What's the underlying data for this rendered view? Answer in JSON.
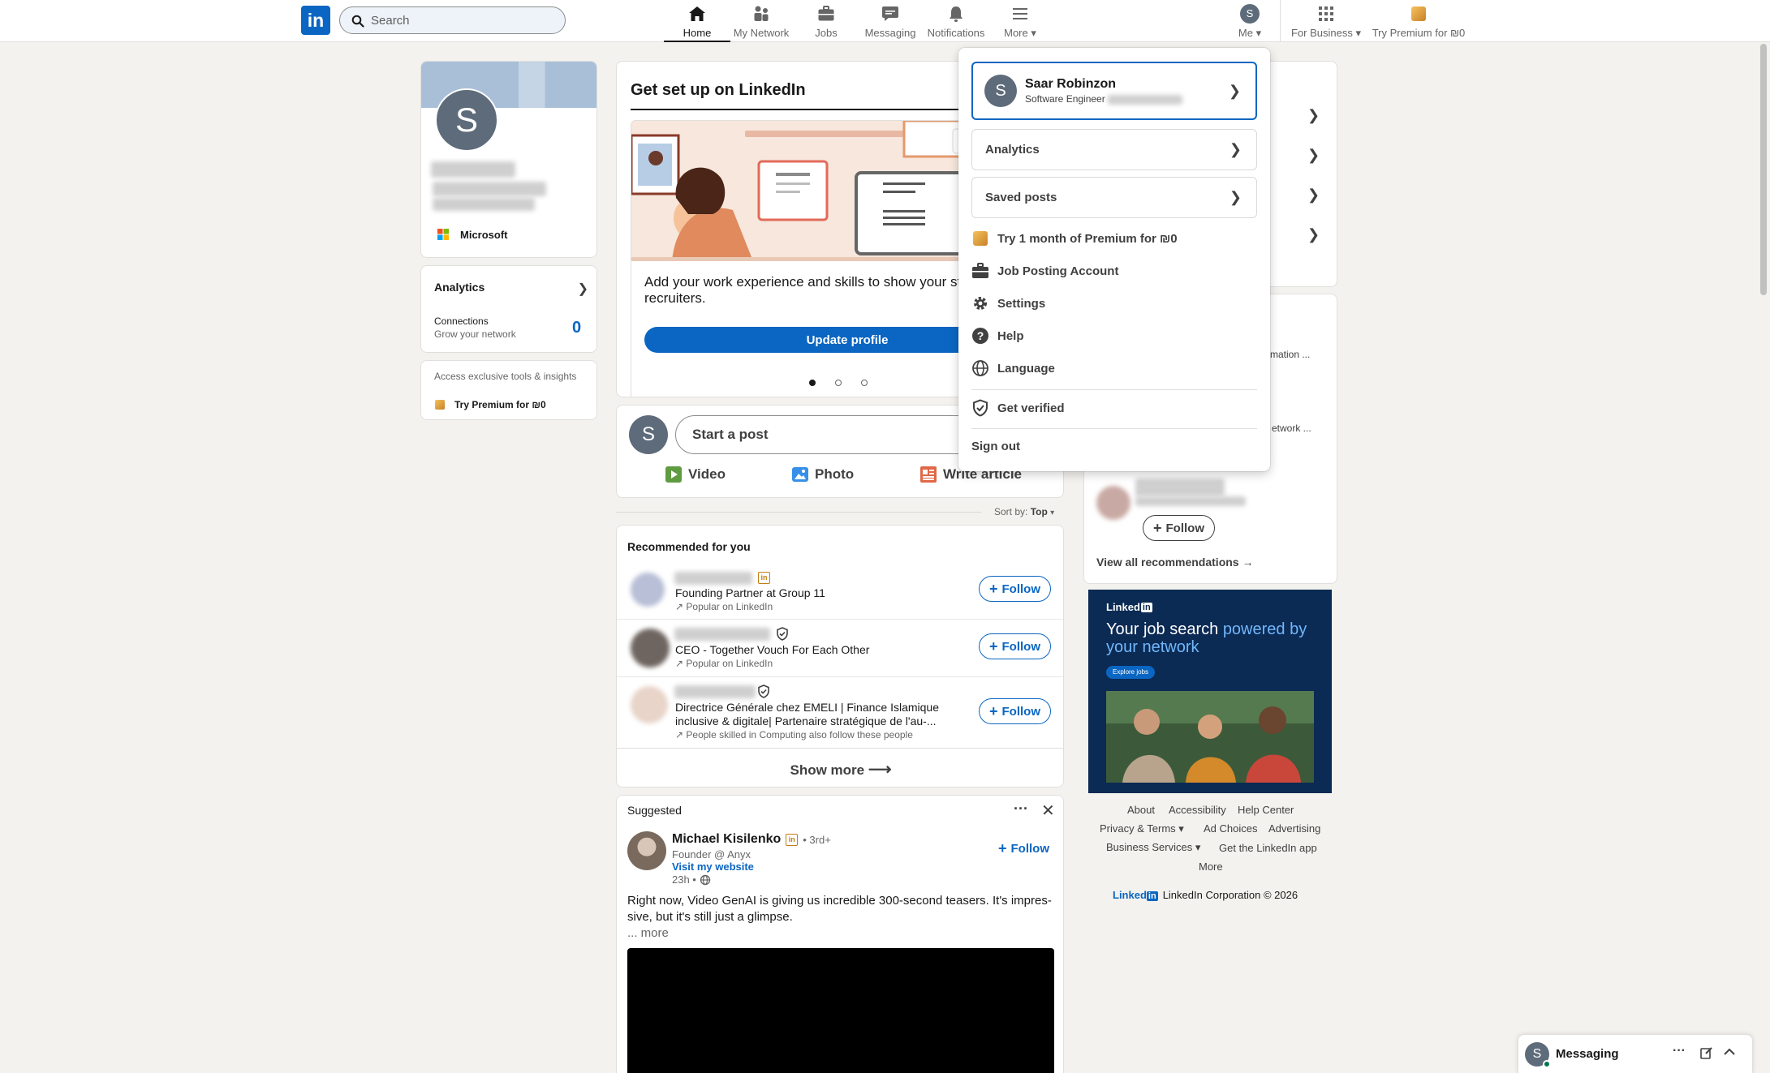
{
  "nav": {
    "logo": "in",
    "search_placeholder": "Search",
    "items": [
      {
        "label": "Home",
        "icon": "home-icon"
      },
      {
        "label": "My Network",
        "icon": "network-icon"
      },
      {
        "label": "Jobs",
        "icon": "jobs-icon"
      },
      {
        "label": "Messaging",
        "icon": "messaging-icon"
      },
      {
        "label": "Notifications",
        "icon": "bell-icon"
      },
      {
        "label": "More",
        "icon": "menu-icon"
      },
      {
        "label": "Me",
        "icon": "avatar"
      },
      {
        "label": "For Business",
        "icon": "grid-icon"
      },
      {
        "label": "Try Premium for ₪0",
        "icon": "premium-icon"
      }
    ],
    "avatar_letter": "S"
  },
  "profile_card": {
    "avatar_letter": "S",
    "company": "Microsoft",
    "analytics_label": "Analytics",
    "connections_label": "Connections",
    "connections_sub": "Grow your network",
    "connections_count": "0",
    "premium_text": "Access exclusive tools & insights",
    "premium_link": "Try Premium for ₪0"
  },
  "setup_card": {
    "title": "Get set up on LinkedIn",
    "text": "Add your work experience and skills to show your strengths to recruiters.",
    "text_visible": "Add your work experience and skills to show your stre",
    "text_line2": "recruiters.",
    "button": "Update profile"
  },
  "post_box": {
    "avatar_letter": "S",
    "placeholder": "Start a post",
    "actions": [
      "Video",
      "Photo",
      "Write article"
    ]
  },
  "sort": {
    "label": "Sort by:",
    "value": "Top"
  },
  "recommended": {
    "title": "Recommended for you",
    "follow_label": "Follow",
    "items": [
      {
        "headline": "Founding Partner at Group 11",
        "line2": "",
        "reason": "Popular on LinkedIn"
      },
      {
        "headline": "CEO - Together Vouch For Each Other",
        "line2": "",
        "reason": "Popular on LinkedIn"
      },
      {
        "headline": "Directrice Générale chez EMELI | Finance Islamique",
        "line2": "inclusive & digitale| Partenaire stratégique de l'au-...",
        "reason": "People skilled in Computing also follow these people"
      }
    ],
    "show_more": "Show more"
  },
  "suggested": {
    "title": "Suggested",
    "author": "Michael Kisilenko",
    "degree": "• 3rd+",
    "subtitle": "Founder @ Anyx",
    "website": "Visit my website",
    "time": "23h •",
    "follow_label": "Follow",
    "text_line1": "Right now, Video GenAI is giving us incredible 300-second teasers. It's impres-",
    "text_line2": "sive, but it's still just a glimpse.",
    "more": "... more"
  },
  "right_rail": {
    "snippet1": "rmation ...",
    "snippet2": "etwork ...",
    "follow_label": "Follow",
    "view_all": "View all recommendations →"
  },
  "ad": {
    "brand": "Linked",
    "brand_in": "in",
    "headline_1": "Your job search ",
    "headline_highlight": "powered by",
    "headline_2": "your network",
    "cta": "Explore jobs"
  },
  "footer": {
    "links": [
      "About",
      "Accessibility",
      "Help Center",
      "Privacy & Terms",
      "Ad Choices",
      "Advertising",
      "Business Services",
      "Get the LinkedIn app",
      "More"
    ],
    "brand": "Linked",
    "brand_in": "in",
    "copyright": "LinkedIn Corporation © 2026"
  },
  "me_menu": {
    "name": "Saar Robinzon",
    "title": "Software Engineer",
    "avatar_letter": "S",
    "analytics": "Analytics",
    "saved_posts": "Saved posts",
    "items": [
      {
        "label": "Try 1 month of Premium for ₪0",
        "icon": "premium-icon"
      },
      {
        "label": "Job Posting Account",
        "icon": "briefcase-icon"
      },
      {
        "label": "Settings",
        "icon": "gear-icon"
      },
      {
        "label": "Help",
        "icon": "help-icon"
      },
      {
        "label": "Language",
        "icon": "globe-icon"
      }
    ],
    "verified": "Get verified",
    "sign_out": "Sign out"
  },
  "messaging": {
    "label": "Messaging",
    "avatar_letter": "S"
  },
  "colors": {
    "brand": "#0a66c2",
    "background": "#f4f2ee",
    "premium": "#e7a33e",
    "ad_bg": "#0b2a54",
    "ad_highlight": "#71b7fb"
  }
}
